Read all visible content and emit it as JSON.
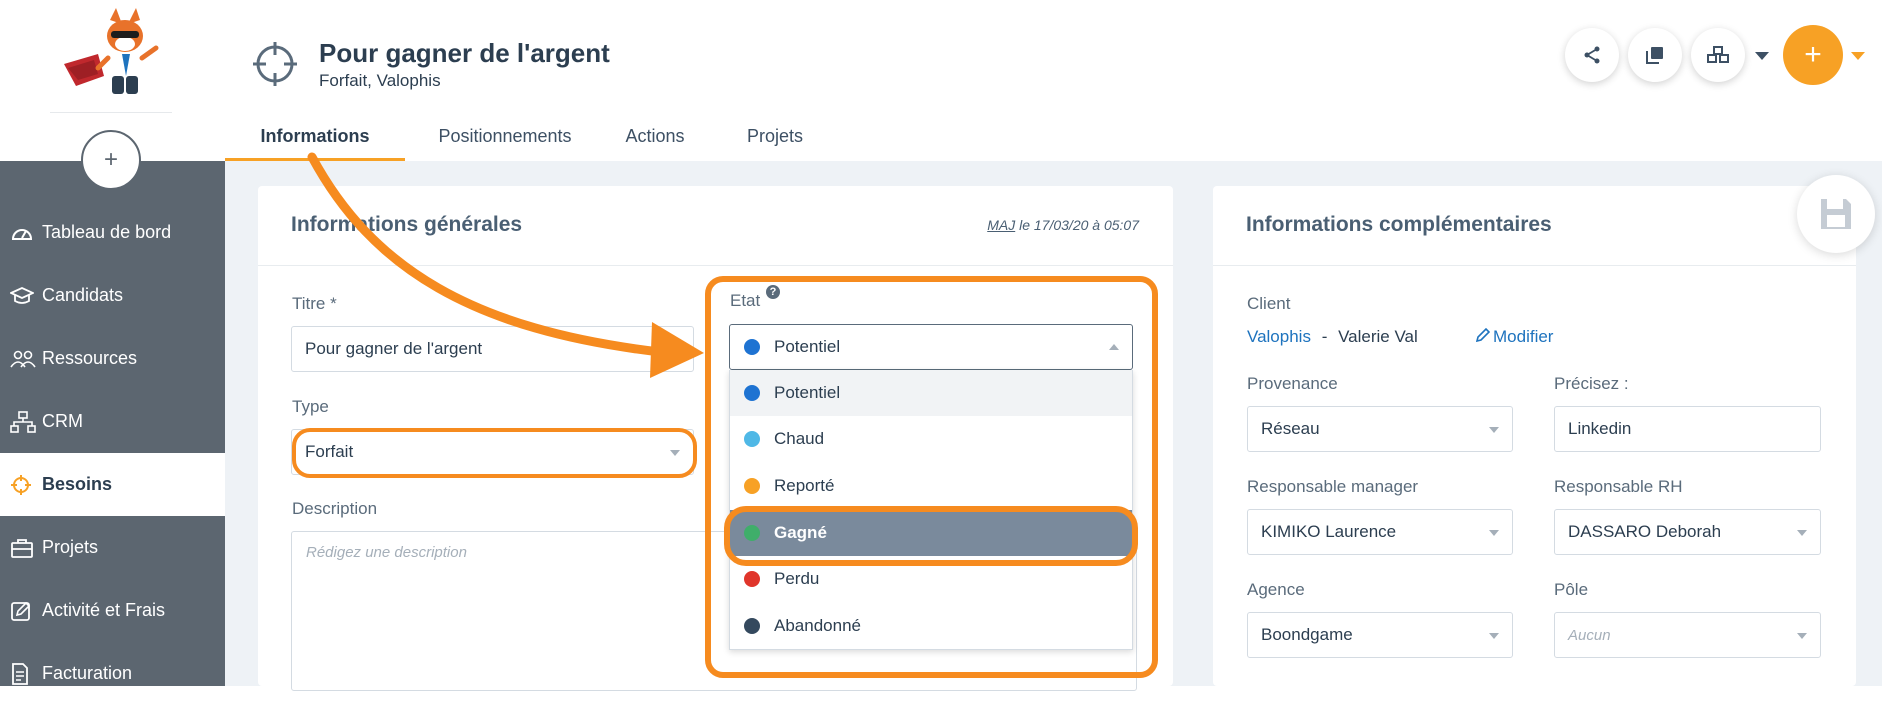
{
  "sidebar": {
    "items": [
      {
        "label": "Tableau de bord",
        "icon": "dashboard-icon"
      },
      {
        "label": "Candidats",
        "icon": "graduation-cap-icon"
      },
      {
        "label": "Ressources",
        "icon": "users-icon"
      },
      {
        "label": "CRM",
        "icon": "org-chart-icon"
      },
      {
        "label": "Besoins",
        "icon": "target-icon",
        "active": true
      },
      {
        "label": "Projets",
        "icon": "briefcase-icon"
      },
      {
        "label": "Activité et Frais",
        "icon": "edit-icon"
      },
      {
        "label": "Facturation",
        "icon": "invoice-icon"
      }
    ]
  },
  "header": {
    "title": "Pour gagner de l'argent",
    "subtitle": "Forfait, Valophis",
    "tabs": [
      "Informations",
      "Positionnements",
      "Actions",
      "Projets"
    ]
  },
  "general": {
    "title": "Informations générales",
    "maj_label": "MAJ",
    "maj_text": " le 17/03/20 à 05:07",
    "titre_label": "Titre *",
    "titre_value": "Pour gagner de l'argent",
    "type_label": "Type",
    "type_value": "Forfait",
    "description_label": "Description",
    "description_placeholder": "Rédigez une description",
    "etat_label": "Etat",
    "etat_help": "?",
    "etat_value": "Potentiel",
    "etat_options": [
      {
        "label": "Potentiel",
        "color": "#1e73d2"
      },
      {
        "label": "Chaud",
        "color": "#4fb8e6"
      },
      {
        "label": "Reporté",
        "color": "#f7a125"
      },
      {
        "label": "Gagné",
        "color": "#3fae6a"
      },
      {
        "label": "Perdu",
        "color": "#e0352b"
      },
      {
        "label": "Abandonné",
        "color": "#34495e"
      }
    ]
  },
  "complementary": {
    "title": "Informations complémentaires",
    "client_label": "Client",
    "client_company": "Valophis",
    "client_separator": "-",
    "client_contact": "Valerie Val",
    "modify_label": "Modifier",
    "provenance_label": "Provenance",
    "provenance_value": "Réseau",
    "precisez_label": "Précisez :",
    "precisez_value": "Linkedin",
    "manager_label": "Responsable manager",
    "manager_value": "KIMIKO Laurence",
    "rh_label": "Responsable RH",
    "rh_value": "DASSARO Deborah",
    "agence_label": "Agence",
    "agence_value": "Boondgame",
    "pole_label": "Pôle",
    "pole_value": "Aucun"
  },
  "colors": {
    "accent": "#f7a125",
    "highlight": "#f68b1f",
    "sidebar": "#5c6670",
    "selected_option": "#7a8a9c"
  }
}
